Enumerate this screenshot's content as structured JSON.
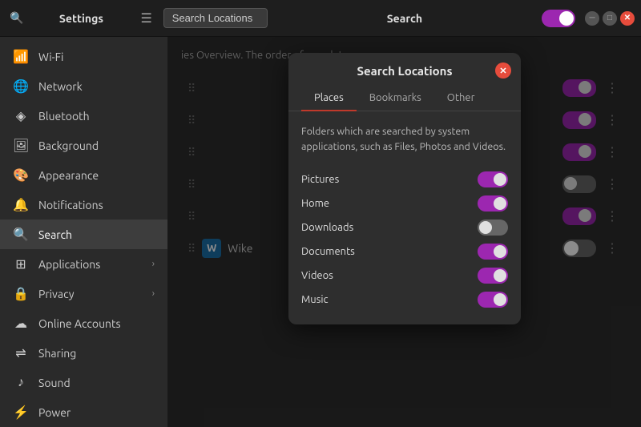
{
  "titlebar": {
    "search_icon": "🔍",
    "app_title": "Settings",
    "menu_icon": "☰",
    "search_box_value": "Search Locations",
    "center_title": "Search",
    "toggle_state": "on",
    "minimize_label": "─",
    "maximize_label": "□",
    "close_label": "✕"
  },
  "sidebar": {
    "items": [
      {
        "id": "wifi",
        "icon": "📶",
        "label": "Wi-Fi",
        "active": false,
        "has_chevron": false
      },
      {
        "id": "network",
        "icon": "🌐",
        "label": "Network",
        "active": false,
        "has_chevron": false
      },
      {
        "id": "bluetooth",
        "icon": "🔵",
        "label": "Bluetooth",
        "active": false,
        "has_chevron": false
      },
      {
        "id": "background",
        "icon": "🖼",
        "label": "Background",
        "active": false,
        "has_chevron": false
      },
      {
        "id": "appearance",
        "icon": "🎨",
        "label": "Appearance",
        "active": false,
        "has_chevron": false
      },
      {
        "id": "notifications",
        "icon": "🔔",
        "label": "Notifications",
        "active": false,
        "has_chevron": false
      },
      {
        "id": "search",
        "icon": "🔍",
        "label": "Search",
        "active": true,
        "has_chevron": false
      },
      {
        "id": "applications",
        "icon": "⊞",
        "label": "Applications",
        "active": false,
        "has_chevron": true
      },
      {
        "id": "privacy",
        "icon": "🔒",
        "label": "Privacy",
        "active": false,
        "has_chevron": true
      },
      {
        "id": "online-accounts",
        "icon": "☁",
        "label": "Online Accounts",
        "active": false,
        "has_chevron": false
      },
      {
        "id": "sharing",
        "icon": "🔗",
        "label": "Sharing",
        "active": false,
        "has_chevron": false
      },
      {
        "id": "sound",
        "icon": "🔊",
        "label": "Sound",
        "active": false,
        "has_chevron": false
      },
      {
        "id": "power",
        "icon": "⚡",
        "label": "Power",
        "active": false,
        "has_chevron": false
      }
    ]
  },
  "content": {
    "description": "ies Overview. The order of search t.",
    "rows": [
      {
        "id": "row1",
        "toggle_state": "on",
        "has_handle": true
      },
      {
        "id": "row2",
        "toggle_state": "on",
        "has_handle": true
      },
      {
        "id": "row3",
        "toggle_state": "on",
        "has_handle": true
      },
      {
        "id": "row4",
        "toggle_state": "off",
        "has_handle": true
      },
      {
        "id": "row5",
        "toggle_state": "on",
        "has_handle": true
      },
      {
        "id": "wike",
        "name": "Wike",
        "icon_letter": "W",
        "toggle_state": "off",
        "has_handle": true
      }
    ]
  },
  "modal": {
    "title": "Search Locations",
    "close_icon": "✕",
    "tabs": [
      {
        "id": "places",
        "label": "Places",
        "active": true
      },
      {
        "id": "bookmarks",
        "label": "Bookmarks",
        "active": false
      },
      {
        "id": "other",
        "label": "Other",
        "active": false
      }
    ],
    "description": "Folders which are searched by system applications, such as Files, Photos and Videos.",
    "locations": [
      {
        "id": "pictures",
        "name": "Pictures",
        "toggle_state": "on"
      },
      {
        "id": "home",
        "name": "Home",
        "toggle_state": "on"
      },
      {
        "id": "downloads",
        "name": "Downloads",
        "toggle_state": "off"
      },
      {
        "id": "documents",
        "name": "Documents",
        "toggle_state": "on"
      },
      {
        "id": "videos",
        "name": "Videos",
        "toggle_state": "on"
      },
      {
        "id": "music",
        "name": "Music",
        "toggle_state": "on"
      }
    ]
  }
}
